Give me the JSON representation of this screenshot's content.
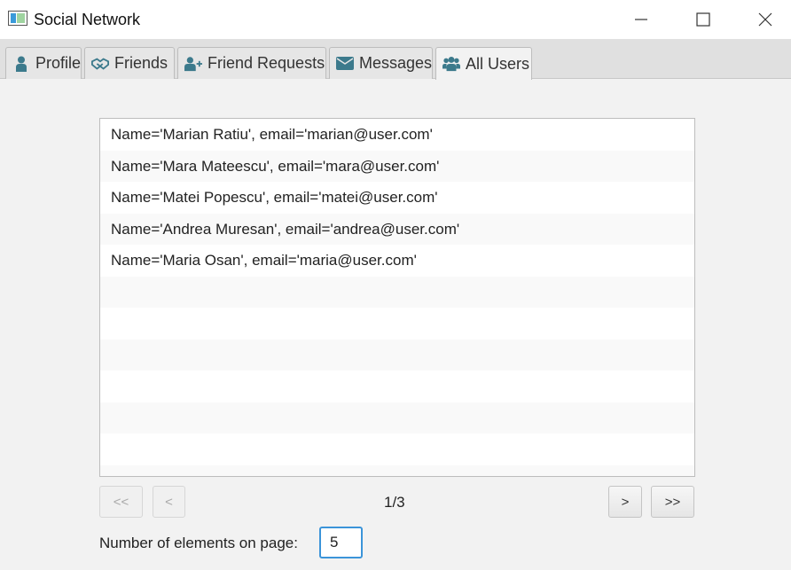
{
  "window": {
    "title": "Social Network"
  },
  "tabs": [
    {
      "label": "Profile",
      "icon": "user-icon"
    },
    {
      "label": "Friends",
      "icon": "handshake-icon"
    },
    {
      "label": "Friend Requests",
      "icon": "user-plus-icon"
    },
    {
      "label": "Messages",
      "icon": "envelope-icon"
    },
    {
      "label": "All Users",
      "icon": "users-icon",
      "active": true
    }
  ],
  "users_list": [
    "Name='Marian Ratiu', email='marian@user.com'",
    "Name='Mara Mateescu', email='mara@user.com'",
    "Name='Matei Popescu', email='matei@user.com'",
    "Name='Andrea Muresan', email='andrea@user.com'",
    "Name='Maria Osan', email='maria@user.com'"
  ],
  "pagination": {
    "first_label": "<<",
    "prev_label": "<",
    "next_label": ">",
    "last_label": ">>",
    "page_indicator": "1/3"
  },
  "page_size": {
    "label": "Number of elements on page:",
    "value": "5"
  },
  "colors": {
    "icon_accent": "#3c7a8c",
    "input_focus": "#3b94d9"
  }
}
